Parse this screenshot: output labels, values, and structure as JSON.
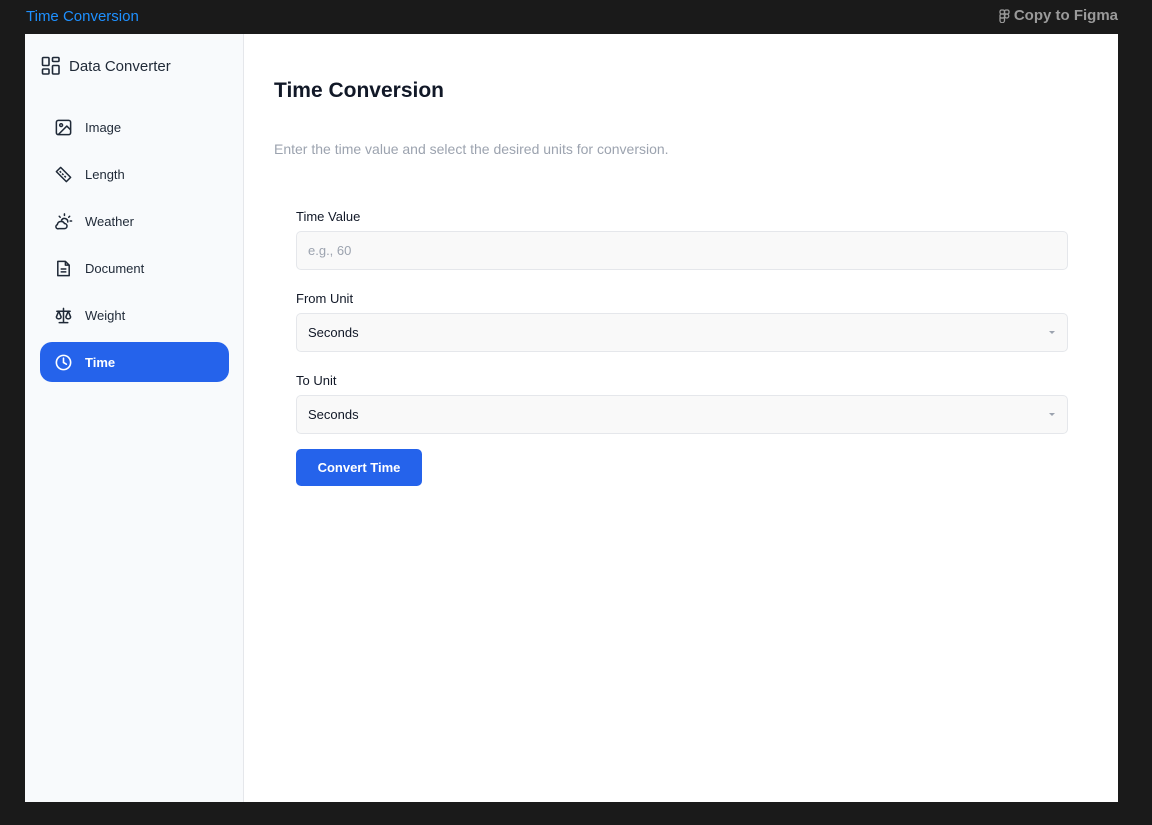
{
  "window": {
    "title": "Time Conversion",
    "copy_figma_label": "Copy to Figma"
  },
  "sidebar": {
    "brand": "Data Converter",
    "items": [
      {
        "label": "Image",
        "icon": "image-icon"
      },
      {
        "label": "Length",
        "icon": "ruler-icon"
      },
      {
        "label": "Weather",
        "icon": "cloud-sun-icon"
      },
      {
        "label": "Document",
        "icon": "document-icon"
      },
      {
        "label": "Weight",
        "icon": "scale-icon"
      },
      {
        "label": "Time",
        "icon": "clock-icon",
        "active": true
      }
    ]
  },
  "main": {
    "title": "Time Conversion",
    "subtitle": "Enter the time value and select the desired units for conversion.",
    "time_value": {
      "label": "Time Value",
      "value": "",
      "placeholder": "e.g., 60"
    },
    "from_unit": {
      "label": "From Unit",
      "selected": "Seconds"
    },
    "to_unit": {
      "label": "To Unit",
      "selected": "Seconds"
    },
    "convert_label": "Convert Time"
  },
  "colors": {
    "accent": "#2563eb",
    "topbar_title": "#1e90ff",
    "background": "#1a1a1a"
  }
}
